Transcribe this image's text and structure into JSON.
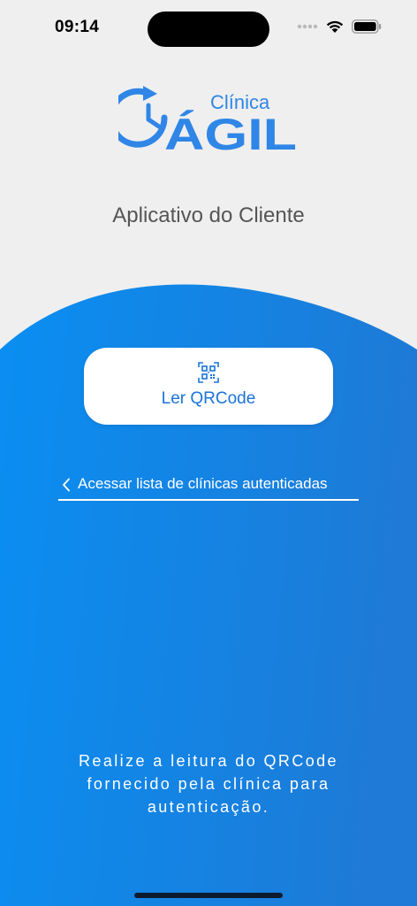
{
  "status_bar": {
    "time": "09:14"
  },
  "logo": {
    "top_text": "Clínica",
    "main_text": "ÁGIL",
    "color": "#2f86e6"
  },
  "subtitle": "Aplicativo do Cliente",
  "qr_button": {
    "label": "Ler QRCode",
    "icon": "qrcode-icon"
  },
  "list_link": {
    "label": "Acessar lista de clínicas autenticadas",
    "icon": "chevron-left-icon"
  },
  "footer": {
    "line1": "Realize a leitura do QRCode",
    "line2": "fornecido pela clínica para",
    "line3": "autenticação."
  },
  "colors": {
    "background": "#efefef",
    "gradient_start": "#0a8ef2",
    "gradient_end": "#1e7ad6",
    "accent": "#1a73d9"
  }
}
